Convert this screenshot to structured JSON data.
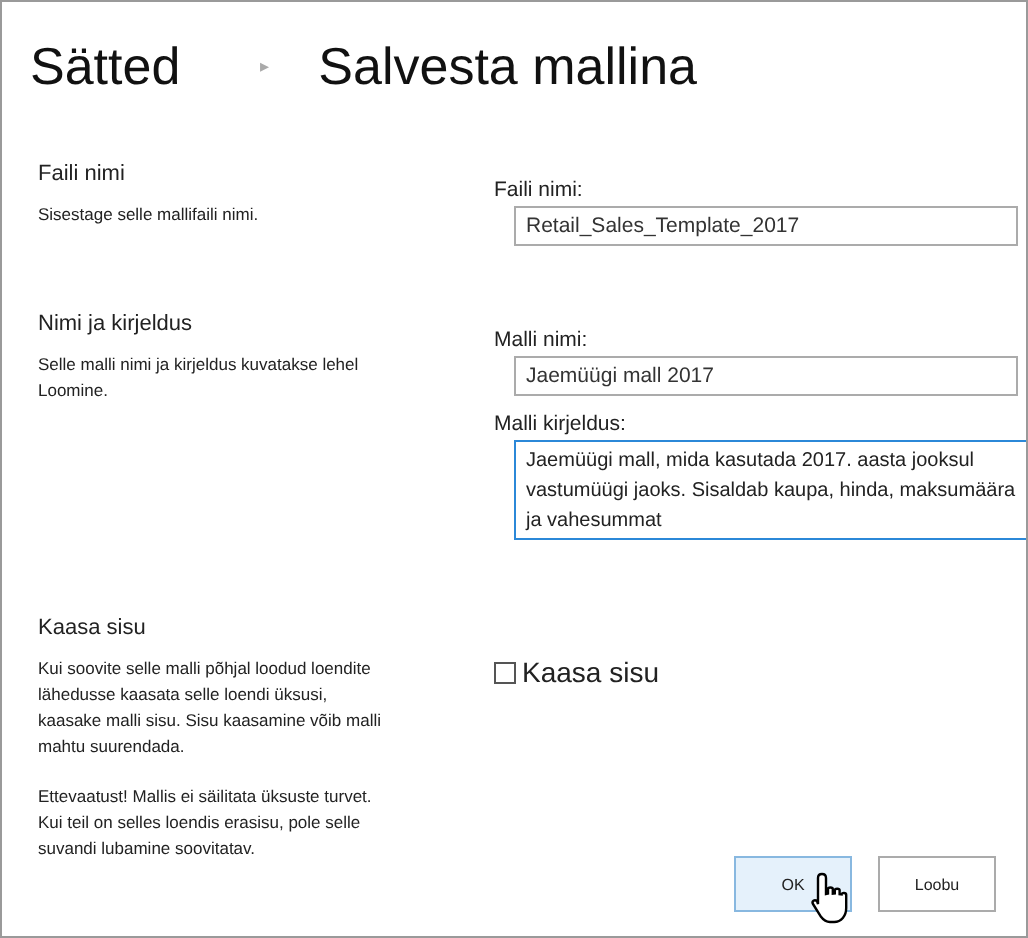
{
  "breadcrumb": {
    "parent": "Sätted",
    "separator": "▸",
    "title": "Salvesta mallina"
  },
  "sections": [
    {
      "title": "Faili nimi",
      "paragraphs": [
        "Sisestage selle mallifaili nimi."
      ],
      "fields": [
        {
          "kind": "input",
          "label": "Faili nimi:",
          "value": "Retail_Sales_Template_2017",
          "focused": false
        }
      ]
    },
    {
      "title": "Nimi ja kirjeldus",
      "paragraphs": [
        "Selle malli nimi ja kirjeldus kuvatakse lehel Loomine."
      ],
      "fields": [
        {
          "kind": "input",
          "label": "Malli nimi:",
          "value": "Jaemüügi mall 2017",
          "focused": false
        },
        {
          "kind": "textarea",
          "label": "Malli kirjeldus:",
          "value": "Jaemüügi mall, mida kasutada 2017. aasta jooksul vastumüügi jaoks. Sisaldab kaupa, hinda, maksumäära ja vahesummat",
          "focused": true
        }
      ]
    },
    {
      "title": "Kaasa sisu",
      "paragraphs": [
        "Kui soovite selle malli põhjal loodud loendite lähedusse kaasata selle loendi üksusi, kaasake malli sisu. Sisu kaasamine võib malli mahtu suurendada.",
        "Ettevaatust! Mallis ei säilitata üksuste turvet. Kui teil on selles loendis erasisu, pole selle suvandi lubamine soovitatav."
      ],
      "fields": [
        {
          "kind": "checkbox",
          "label": "Kaasa sisu",
          "checked": false
        }
      ]
    }
  ],
  "buttons": [
    {
      "label": "OK",
      "hovered": true
    },
    {
      "label": "Loobu",
      "hovered": false
    }
  ]
}
